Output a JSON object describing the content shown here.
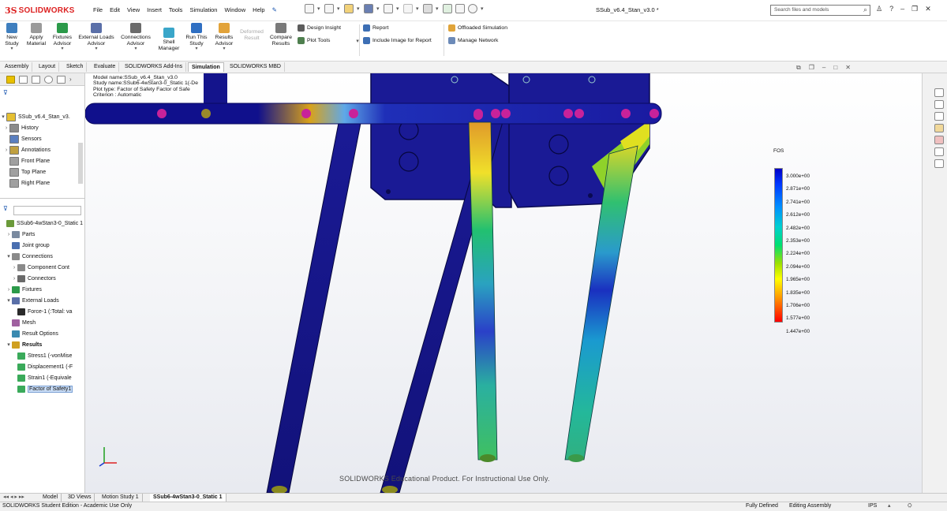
{
  "app": {
    "brand": "SOLIDWORKS",
    "doc_title": "SSub_v6.4_Stan_v3.0 *"
  },
  "menu": [
    "File",
    "Edit",
    "View",
    "Insert",
    "Tools",
    "Simulation",
    "Window",
    "Help"
  ],
  "search": {
    "placeholder": "Search files and models"
  },
  "ribbon": {
    "new_study": [
      "New",
      "Study"
    ],
    "apply_material": [
      "Apply",
      "Material"
    ],
    "fixtures_advisor": [
      "Fixtures",
      "Advisor"
    ],
    "external_loads": [
      "External Loads",
      "Advisor"
    ],
    "connections": [
      "Connections",
      "Advisor"
    ],
    "shell_manager": [
      "Shell",
      "Manager"
    ],
    "run_study": [
      "Run This",
      "Study"
    ],
    "results_advisor": [
      "Results",
      "Advisor"
    ],
    "deformed_result": [
      "Deformed",
      "Result"
    ],
    "compare_results": [
      "Compare",
      "Results"
    ],
    "design_insight": "Design Insight",
    "plot_tools": "Plot Tools",
    "report": "Report",
    "include_image": "Include Image for Report",
    "offloaded_sim": "Offloaded Simulation",
    "manage_network": "Manage Network"
  },
  "tabs": [
    "Assembly",
    "Layout",
    "Sketch",
    "Evaluate",
    "SOLIDWORKS Add-Ins",
    "Simulation",
    "SOLIDWORKS MBD"
  ],
  "feature_tree": [
    {
      "label": "SSub_v6.4_Stan_v3.",
      "exp": "▾",
      "bold": false
    },
    {
      "label": "History",
      "exp": "›"
    },
    {
      "label": "Sensors",
      "exp": ""
    },
    {
      "label": "Annotations",
      "exp": "›"
    },
    {
      "label": "Front Plane",
      "exp": ""
    },
    {
      "label": "Top Plane",
      "exp": ""
    },
    {
      "label": "Right Plane",
      "exp": ""
    }
  ],
  "sim_tree": [
    {
      "label": "SSub6-4wStan3-0_Static 1",
      "exp": "",
      "indent": 0
    },
    {
      "label": "Parts",
      "exp": "›",
      "indent": 1
    },
    {
      "label": "Joint group",
      "exp": "",
      "indent": 1
    },
    {
      "label": "Connections",
      "exp": "▾",
      "indent": 1
    },
    {
      "label": "Component Cont",
      "exp": "›",
      "indent": 2
    },
    {
      "label": "Connectors",
      "exp": "›",
      "indent": 2
    },
    {
      "label": "Fixtures",
      "exp": "›",
      "indent": 1
    },
    {
      "label": "External Loads",
      "exp": "▾",
      "indent": 1
    },
    {
      "label": "Force-1 (:Total: va",
      "exp": "",
      "indent": 2
    },
    {
      "label": "Mesh",
      "exp": "",
      "indent": 1
    },
    {
      "label": "Result Options",
      "exp": "",
      "indent": 1
    },
    {
      "label": "Results",
      "exp": "▾",
      "indent": 1,
      "bold": true
    },
    {
      "label": "Stress1 (-vonMise",
      "exp": "",
      "indent": 2
    },
    {
      "label": "Displacement1 (-F",
      "exp": "",
      "indent": 2
    },
    {
      "label": "Strain1 (-Equivale",
      "exp": "",
      "indent": 2
    },
    {
      "label": "Factor of Safety1",
      "exp": "",
      "indent": 2,
      "selected": true
    }
  ],
  "plot_info": [
    "Model name:SSub_v6.4_Stan_v3.0",
    "Study name:SSub6-4wStan3-0_Static 1(-De",
    "Plot type: Factor of Safety Factor of Safe",
    "Criterion : Automatic"
  ],
  "legend": {
    "title": "FOS",
    "ticks": [
      "3.000e+00",
      "2.871e+00",
      "2.741e+00",
      "2.612e+00",
      "2.482e+00",
      "2.353e+00",
      "2.224e+00",
      "2.094e+00",
      "1.965e+00",
      "1.835e+00",
      "1.706e+00",
      "1.577e+00",
      "1.447e+00"
    ]
  },
  "watermark": "SOLIDWORKS Educational Product. For Instructional Use Only.",
  "bottom_tabs": [
    "Model",
    "3D Views",
    "Motion Study 1",
    "SSub6-4wStan3-0_Static 1"
  ],
  "status": {
    "edition": "SOLIDWORKS Student Edition - Academic Use Only",
    "defined": "Fully Defined",
    "mode": "Editing Assembly",
    "units": "IPS"
  },
  "colors": {
    "brand": "#d22222",
    "selection": "#c9dcf5",
    "model_blue": "#14148c"
  }
}
